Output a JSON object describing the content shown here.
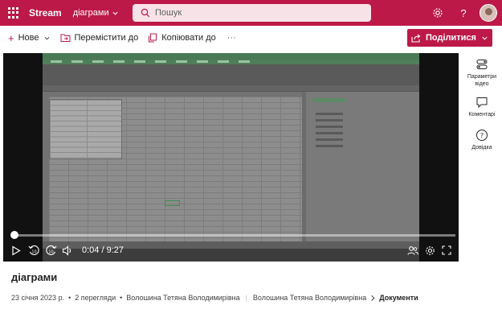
{
  "header": {
    "app_name": "Stream",
    "site_name": "діаграми",
    "search_placeholder": "Пошук",
    "brand_color": "#bc1948"
  },
  "commands": {
    "new_label": "Нове",
    "move_label": "Перемістити до",
    "copy_label": "Копіювати до",
    "more_label": "···",
    "share_label": "Поділитися"
  },
  "player": {
    "current_time": "0:04",
    "duration": "9:27",
    "progress_fraction": 0.007
  },
  "side_panel": {
    "settings_label": "Параметри відео",
    "comments_label": "Коментарі",
    "help_label": "Довідка"
  },
  "video": {
    "title": "діаграми",
    "date": "23 січня 2023 р.",
    "views": "2 перегляди",
    "author": "Волошина Тетяна Володимирівна",
    "breadcrumb_owner": "Волошина Тетяна Володимирівна",
    "breadcrumb_folder": "Документи"
  }
}
